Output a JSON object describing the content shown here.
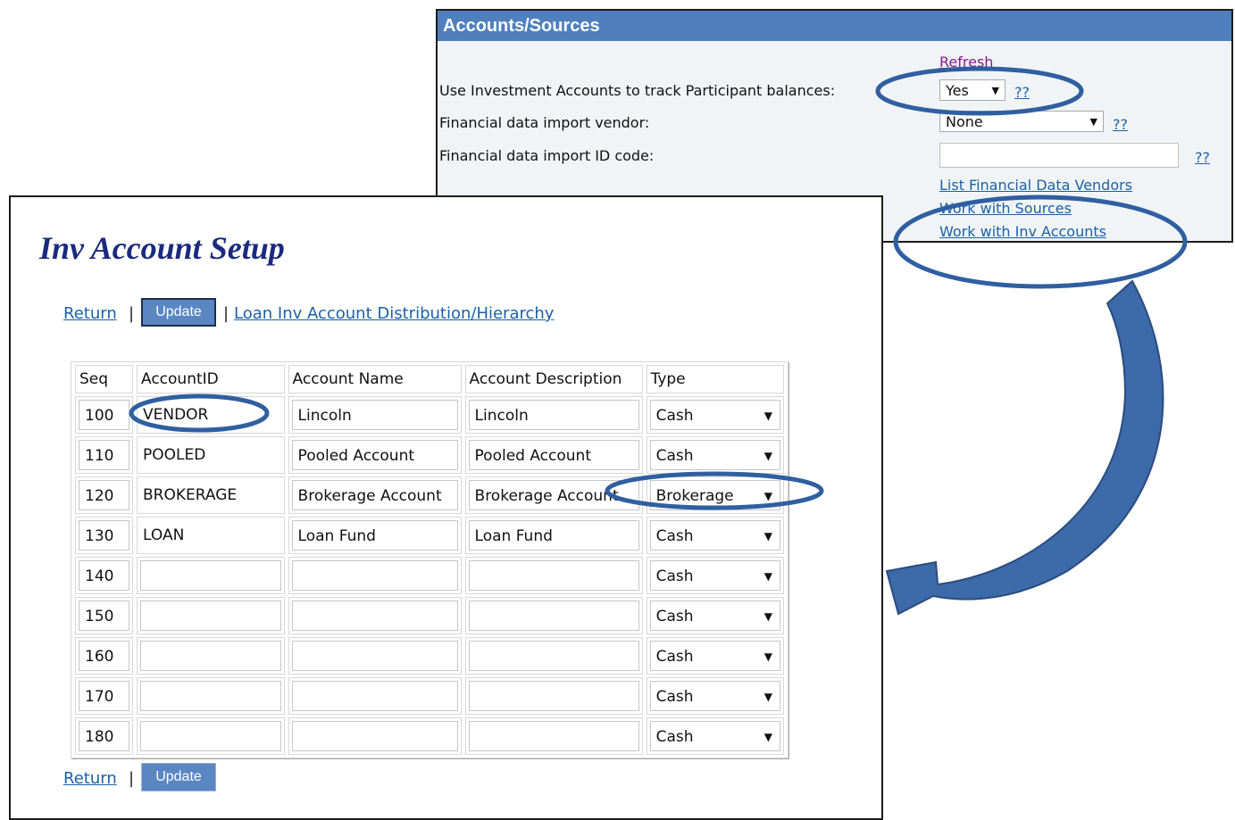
{
  "accounts_panel": {
    "title": "Accounts/Sources",
    "refresh_link": "Refresh",
    "rows": [
      {
        "label": "Use Investment Accounts to track Participant balances:",
        "value": "Yes",
        "help": "??"
      },
      {
        "label": "Financial data import vendor:",
        "value": "None",
        "help": "??"
      },
      {
        "label": "Financial data import ID code:",
        "value": "",
        "help": "??"
      }
    ],
    "links": [
      "List Financial Data Vendors",
      "Work with Sources",
      "Work with Inv Accounts"
    ]
  },
  "inv_setup": {
    "title": "Inv Account Setup",
    "return_label": "Return",
    "update_label": "Update",
    "separator": "|",
    "loan_link": "Loan Inv Account Distribution/Hierarchy",
    "columns": [
      "Seq",
      "AccountID",
      "Account Name",
      "Account Description",
      "Type"
    ],
    "rows": [
      {
        "seq": "100",
        "id": "VENDOR",
        "name": "Lincoln",
        "desc": "Lincoln",
        "type": "Cash"
      },
      {
        "seq": "110",
        "id": "POOLED",
        "name": "Pooled Account",
        "desc": "Pooled Account",
        "type": "Cash"
      },
      {
        "seq": "120",
        "id": "BROKERAGE",
        "name": "Brokerage Account",
        "desc": "Brokerage Account",
        "type": "Brokerage"
      },
      {
        "seq": "130",
        "id": "LOAN",
        "name": "Loan Fund",
        "desc": "Loan Fund",
        "type": "Cash"
      },
      {
        "seq": "140",
        "id": "",
        "name": "",
        "desc": "",
        "type": "Cash"
      },
      {
        "seq": "150",
        "id": "",
        "name": "",
        "desc": "",
        "type": "Cash"
      },
      {
        "seq": "160",
        "id": "",
        "name": "",
        "desc": "",
        "type": "Cash"
      },
      {
        "seq": "170",
        "id": "",
        "name": "",
        "desc": "",
        "type": "Cash"
      },
      {
        "seq": "180",
        "id": "",
        "name": "",
        "desc": "",
        "type": "Cash"
      }
    ]
  },
  "colors": {
    "header_blue": "#4f7fbd",
    "link_blue": "#1a62a8",
    "visited_link": "#8b1a8b",
    "annotation": "#2f5fa0",
    "title_navy": "#1a2a7e"
  },
  "icons": {
    "dropdown": "dropdown-arrow-icon",
    "annotation_arrow": "curved-arrow-icon"
  }
}
